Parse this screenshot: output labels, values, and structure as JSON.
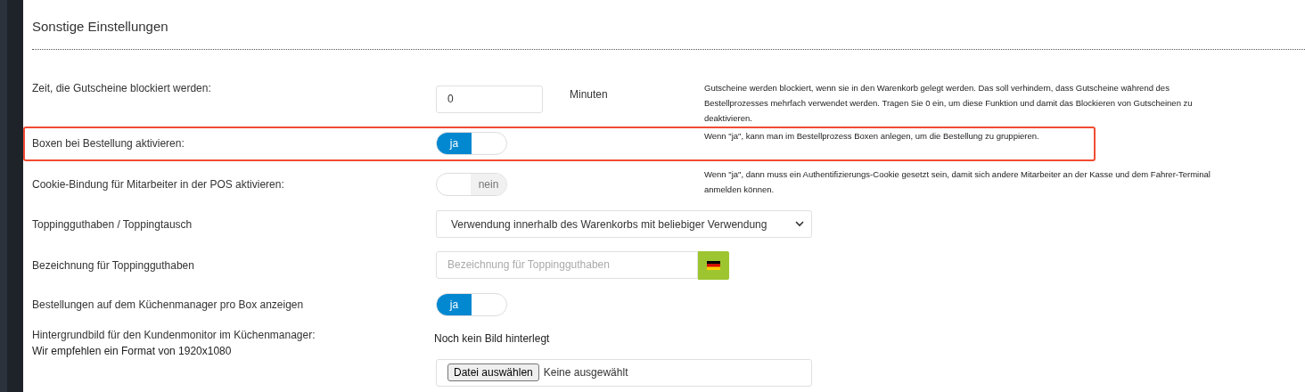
{
  "section": {
    "title": "Sonstige Einstellungen"
  },
  "rows": [
    {
      "kind": "number",
      "label": "Zeit, die Gutscheine blockiert werden:",
      "value": "0",
      "unit": "Minuten",
      "help": "Gutscheine werden blockiert, wenn sie in den Warenkorb gelegt werden. Das soll verhindern, dass Gutscheine während des Bestellprozesses mehrfach verwendet werden. Tragen Sie 0 ein, um diese Funktion und damit das Blockieren von Gutscheinen zu deaktivieren.",
      "highlighted": false
    },
    {
      "kind": "toggle",
      "label": "Boxen bei Bestellung aktivieren:",
      "on": true,
      "state_text": "ja",
      "help": "Wenn \"ja\", kann man im Bestellprozess Boxen anlegen, um die Bestellung zu gruppieren.",
      "highlighted": true
    },
    {
      "kind": "toggle",
      "label": "Cookie-Bindung für Mitarbeiter in der POS aktivieren:",
      "on": false,
      "state_text": "nein",
      "help": "Wenn \"ja\", dann muss ein Authentifizierungs-Cookie gesetzt sein, damit sich andere Mitarbeiter an der Kasse und dem Fahrer-Terminal anmelden können.",
      "highlighted": false
    },
    {
      "kind": "select",
      "label": "Toppingguthaben / Toppingtausch",
      "value": "Verwendung innerhalb des Warenkorbs mit beliebiger Verwendung",
      "highlighted": false
    },
    {
      "kind": "text",
      "label": "Bezeichnung für Toppingguthaben",
      "placeholder": "Bezeichnung für Toppingguthaben",
      "highlighted": false
    },
    {
      "kind": "toggle",
      "label": "Bestellungen auf dem Küchenmanager pro Box anzeigen",
      "on": true,
      "state_text": "ja",
      "highlighted": false
    },
    {
      "kind": "image",
      "label": "Hintergrundbild für den Kundenmonitor im Küchenmanager:",
      "label_note": "Wir empfehlen ein Format von 1920x1080",
      "status": "Noch kein Bild hinterlegt",
      "file_button": "Datei auswählen",
      "file_status": "Keine ausgewählt",
      "highlighted": false
    }
  ]
}
